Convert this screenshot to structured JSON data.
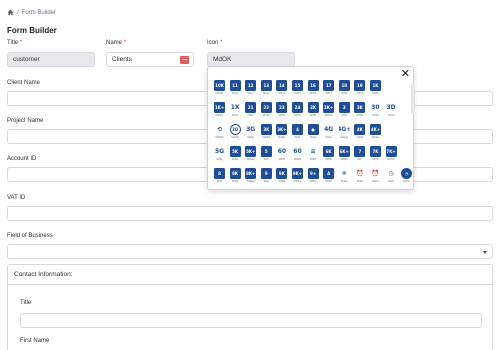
{
  "breadcrumb": {
    "home_icon": "home-icon",
    "separator": "/",
    "current": "Form Builder"
  },
  "page_title": "Form Builder",
  "fields": {
    "title": {
      "label": "Title",
      "required_mark": "*",
      "value": "customer"
    },
    "name": {
      "label": "Name",
      "required_mark": "*",
      "value": "Clients"
    },
    "icon": {
      "label": "Icon",
      "required_mark": "*",
      "value": "MdOK"
    },
    "client_name": {
      "label": "Client Name"
    },
    "project_name": {
      "label": "Project Name"
    },
    "account_id": {
      "label": "Account ID"
    },
    "vat_id": {
      "label": "VAT ID"
    },
    "field_of_business": {
      "label": "Field of Business"
    }
  },
  "contact": {
    "heading": "Contact Information:",
    "title_label": "Title",
    "first_name_label": "First Name"
  },
  "icon_picker": {
    "close_label": "✕",
    "colors": {
      "tile": "#1f4e96"
    },
    "icons": [
      {
        "g": "10K",
        "c": "Md10k"
      },
      {
        "g": "11",
        "c": "Md11"
      },
      {
        "g": "12",
        "c": "Md12"
      },
      {
        "g": "13",
        "c": "Md13"
      },
      {
        "g": "14",
        "c": "Md14"
      },
      {
        "g": "15",
        "c": "Md15"
      },
      {
        "g": "16",
        "c": "Md16"
      },
      {
        "g": "17",
        "c": "Md17"
      },
      {
        "g": "18",
        "c": "Md18"
      },
      {
        "g": "19",
        "c": "Md19"
      },
      {
        "g": "1K",
        "c": "Md1k"
      },
      {
        "g": "",
        "c": ""
      },
      {
        "g": "",
        "c": ""
      },
      {
        "g": "1K+",
        "c": "Md1kp"
      },
      {
        "g": "1X",
        "c": "Md1x",
        "s": "plain"
      },
      {
        "g": "21",
        "c": "Md21"
      },
      {
        "g": "22",
        "c": "Md22"
      },
      {
        "g": "23",
        "c": "Md23"
      },
      {
        "g": "24",
        "c": "Md24"
      },
      {
        "g": "2K",
        "c": "Md2k"
      },
      {
        "g": "2K+",
        "c": "Md2kp"
      },
      {
        "g": "3",
        "c": "Md3"
      },
      {
        "g": "3K",
        "c": "Md3k"
      },
      {
        "g": "30",
        "c": "Md30",
        "s": "plain"
      },
      {
        "g": "3D",
        "c": "Md3d",
        "s": "plain"
      },
      {
        "g": "",
        "c": ""
      },
      {
        "g": "⟲",
        "c": "Md360",
        "s": "plain"
      },
      {
        "g": "3D",
        "c": "Md3dr",
        "s": "outline"
      },
      {
        "g": "3G",
        "c": "Md3g",
        "s": "plain"
      },
      {
        "g": "3K",
        "c": "Md3kb"
      },
      {
        "g": "3K+",
        "c": "Md3kp"
      },
      {
        "g": "4",
        "c": "Md4"
      },
      {
        "g": "●",
        "c": "Md4p"
      },
      {
        "g": "4G",
        "c": "Md4g",
        "s": "plain"
      },
      {
        "g": "4G+",
        "c": "Md4gp",
        "s": "plain"
      },
      {
        "g": "4K",
        "c": "Md4k"
      },
      {
        "g": "4K+",
        "c": "Md4kp"
      },
      {
        "g": "",
        "c": ""
      },
      {
        "g": "",
        "c": ""
      },
      {
        "g": "5G",
        "c": "Md5g",
        "s": "plain"
      },
      {
        "g": "5K",
        "c": "Md5k"
      },
      {
        "g": "5K+",
        "c": "Md5kp"
      },
      {
        "g": "5",
        "c": "Md5"
      },
      {
        "g": "60",
        "c": "Md60",
        "s": "plain"
      },
      {
        "g": "60",
        "c": "Md60f",
        "s": "plain"
      },
      {
        "g": "≡",
        "c": "Md6h",
        "s": "plain"
      },
      {
        "g": "6K",
        "c": "Md6k"
      },
      {
        "g": "6K+",
        "c": "Md6kp"
      },
      {
        "g": "7",
        "c": "Md7"
      },
      {
        "g": "7K",
        "c": "Md7k"
      },
      {
        "g": "7K+",
        "c": "Md7kp"
      },
      {
        "g": "",
        "c": ""
      },
      {
        "g": "8",
        "c": "Md8"
      },
      {
        "g": "8K",
        "c": "Md8k"
      },
      {
        "g": "8K+",
        "c": "Md8kp"
      },
      {
        "g": "9",
        "c": "Md9"
      },
      {
        "g": "9K",
        "c": "Md9k"
      },
      {
        "g": "9K+",
        "c": "Md9kp"
      },
      {
        "g": "9+",
        "c": "Md9p"
      },
      {
        "g": "A",
        "c": "MdAb"
      },
      {
        "g": "❄",
        "c": "MdAc",
        "s": "plain"
      },
      {
        "g": "⏰",
        "c": "MdAl",
        "s": "plain"
      },
      {
        "g": "⏰",
        "c": "MdAm",
        "s": "plain"
      },
      {
        "g": "◷",
        "c": "MdAt",
        "s": "plain"
      },
      {
        "g": "◔",
        "c": "MdAu",
        "s": "round"
      }
    ]
  }
}
